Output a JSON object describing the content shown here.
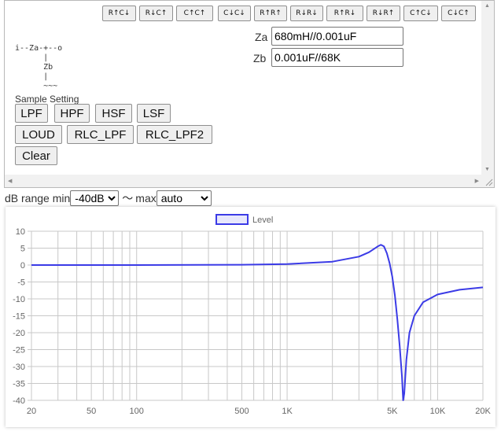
{
  "presets": [
    {
      "label": "R↑C↓"
    },
    {
      "label": "R↓C↑"
    },
    {
      "label": "C↑C↑"
    },
    {
      "label": "C↓C↓"
    },
    {
      "label": "R↑R↑"
    },
    {
      "label": "R↓R↓"
    },
    {
      "label": "R↑R↓"
    },
    {
      "label": "R↓R↑"
    },
    {
      "label": "C↑C↓"
    },
    {
      "label": "C↓C↑"
    }
  ],
  "za": {
    "label": "Za",
    "value": "680mH//0.001uF"
  },
  "zb": {
    "label": "Zb",
    "value": "0.001uF//68K"
  },
  "schematic": "i--Za-+--o\n      |\n      Zb\n      |\n      ~~~",
  "sample": {
    "title": "Sample Setting",
    "buttons": [
      "LPF",
      "HPF",
      "HSF",
      "LSF",
      "LOUD",
      "RLC_LPF",
      "RLC_LPF2",
      "Clear"
    ]
  },
  "range": {
    "label_min": "dB range min",
    "min_value": "-40dB",
    "min_options": [
      "-40dB"
    ],
    "tilde": "〜",
    "label_max": "max",
    "max_value": "auto",
    "max_options": [
      "auto"
    ]
  },
  "chart_data": {
    "type": "line",
    "title": "",
    "legend": "Level",
    "legend_position": "top-center",
    "series_color": "#3b3be6",
    "xscale": "log",
    "xlim": [
      20,
      20000
    ],
    "ylim": [
      -40,
      10
    ],
    "grid": true,
    "x_tick_labels": [
      {
        "value": 20,
        "label": "20"
      },
      {
        "value": 50,
        "label": "50"
      },
      {
        "value": 100,
        "label": "100"
      },
      {
        "value": 500,
        "label": "500"
      },
      {
        "value": 1000,
        "label": "1K"
      },
      {
        "value": 5000,
        "label": "5K"
      },
      {
        "value": 10000,
        "label": "10K"
      },
      {
        "value": 20000,
        "label": "20K"
      }
    ],
    "y_ticks": [
      10,
      5,
      0,
      -5,
      -10,
      -15,
      -20,
      -25,
      -30,
      -35,
      -40
    ],
    "series": [
      {
        "name": "Level",
        "points": [
          [
            20,
            0
          ],
          [
            100,
            0
          ],
          [
            500,
            0.1
          ],
          [
            1000,
            0.3
          ],
          [
            2000,
            1.0
          ],
          [
            3000,
            2.5
          ],
          [
            3500,
            3.8
          ],
          [
            4000,
            5.5
          ],
          [
            4200,
            6.0
          ],
          [
            4400,
            5.5
          ],
          [
            4600,
            3.5
          ],
          [
            4800,
            0.5
          ],
          [
            5000,
            -3.5
          ],
          [
            5200,
            -9
          ],
          [
            5400,
            -16
          ],
          [
            5600,
            -24
          ],
          [
            5800,
            -33
          ],
          [
            5900,
            -40
          ],
          [
            6000,
            -38
          ],
          [
            6200,
            -28
          ],
          [
            6500,
            -20
          ],
          [
            7000,
            -15
          ],
          [
            8000,
            -11
          ],
          [
            10000,
            -8.7
          ],
          [
            14000,
            -7.3
          ],
          [
            20000,
            -6.6
          ]
        ]
      }
    ]
  }
}
